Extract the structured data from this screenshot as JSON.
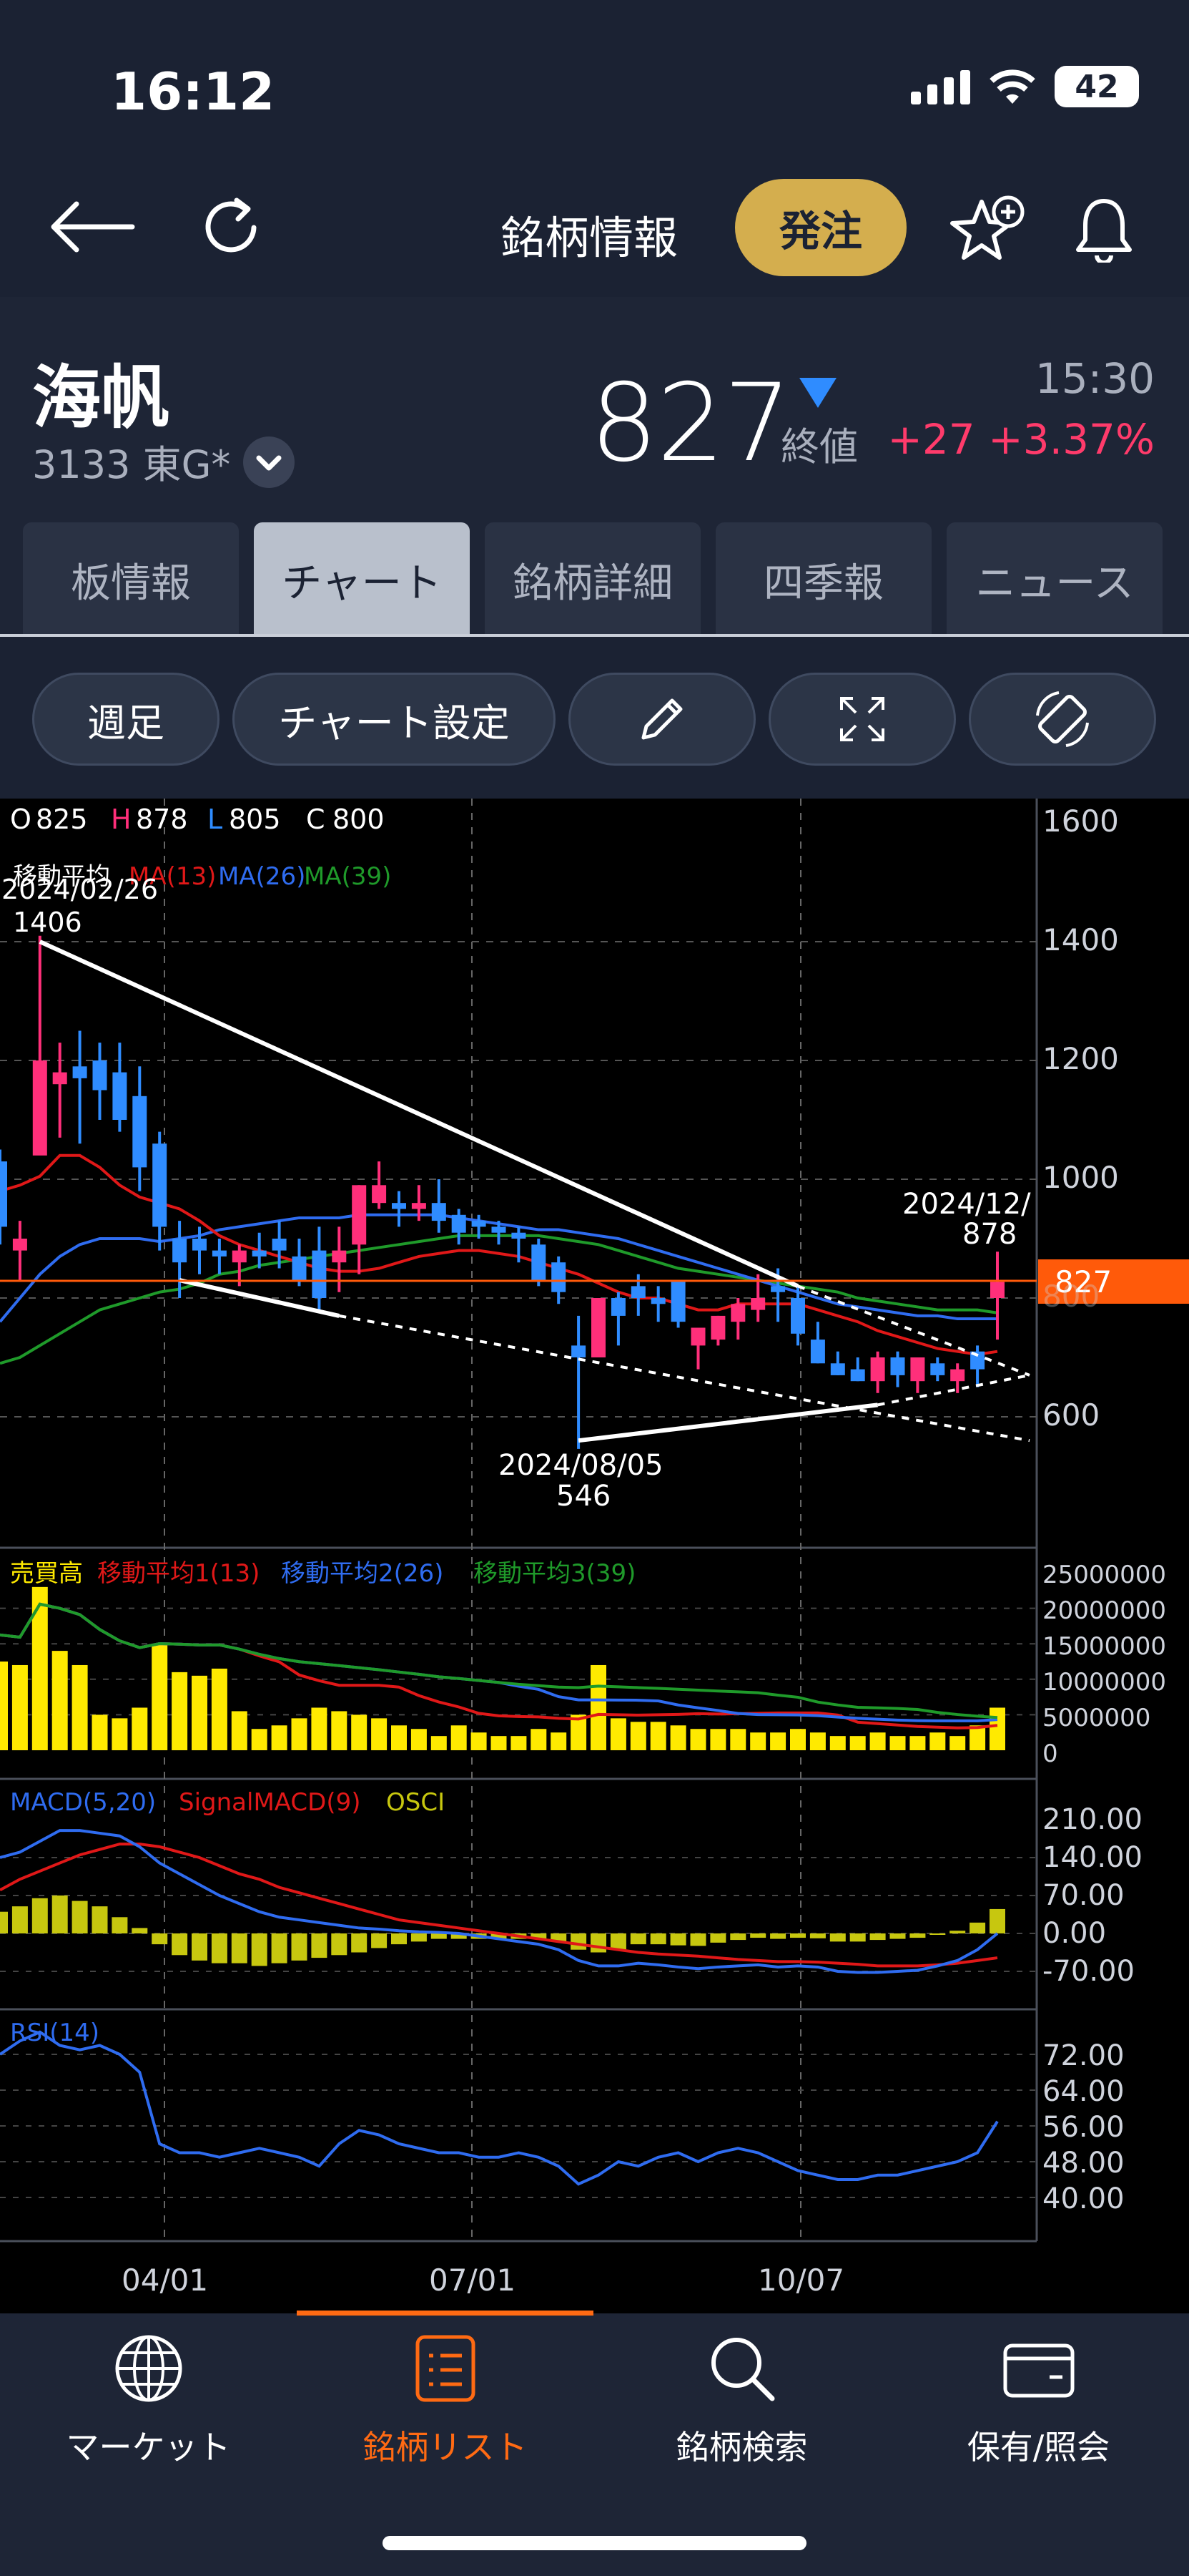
{
  "status_bar": {
    "time": "16:12",
    "battery": "42"
  },
  "nav": {
    "title": "銘柄情報",
    "order_button": "発注"
  },
  "stock": {
    "name": "海帆",
    "code_market": "3133 東G*",
    "price": "827",
    "price_label": "終値",
    "time": "15:30",
    "change": "+27 +3.37%"
  },
  "tabs": [
    {
      "label": "板情報",
      "active": false
    },
    {
      "label": "チャート",
      "active": true
    },
    {
      "label": "銘柄詳細",
      "active": false
    },
    {
      "label": "四季報",
      "active": false
    },
    {
      "label": "ニュース",
      "active": false
    }
  ],
  "toolbar": {
    "period": "週足",
    "settings": "チャート設定"
  },
  "chart": {
    "ohlc": {
      "o_label": "O",
      "o": "825",
      "h_label": "H",
      "h": "878",
      "l_label": "L",
      "l": "805",
      "c_label": "C",
      "c": "800"
    },
    "ma_legend": {
      "title": "移動平均",
      "ma13": "MA(13)",
      "ma26": "MA(26)",
      "ma39": "MA(39)"
    },
    "annotations": {
      "high_date": "2024/02/26",
      "high_value": "1406",
      "low_date": "2024/08/05",
      "low_value": "546",
      "last_date": "2024/12/",
      "last_value": "878"
    },
    "current_price_tag": "827",
    "price_axis": [
      "1600",
      "1400",
      "1200",
      "1000",
      "800",
      "600"
    ],
    "volume_legend": {
      "title": "売買高",
      "ma1": "移動平均1(13)",
      "ma2": "移動平均2(26)",
      "ma3": "移動平均3(39)"
    },
    "volume_axis": [
      "25000000",
      "20000000",
      "15000000",
      "10000000",
      "5000000",
      "0"
    ],
    "macd_legend": {
      "macd": "MACD(5,20)",
      "signal": "SignalMACD(9)",
      "osci": "OSCI"
    },
    "macd_axis": [
      "210.00",
      "140.00",
      "70.00",
      "0.00",
      "-70.00"
    ],
    "rsi_legend": "RSI(14)",
    "rsi_axis": [
      "72.00",
      "64.00",
      "56.00",
      "48.00",
      "40.00"
    ],
    "x_axis": [
      "04/01",
      "07/01",
      "10/07"
    ],
    "colors": {
      "up": "#ff2f7a",
      "down": "#2f8cff",
      "ma13": "#e01818",
      "ma26": "#2f6cf0",
      "ma39": "#1f9a2a",
      "volume": "#ffea00",
      "osci": "#c7c70f",
      "price_tag": "#ff5a0a"
    }
  },
  "chart_data": {
    "type": "candlestick",
    "period": "週足",
    "candles_ohlc": [
      [
        1030,
        1050,
        890,
        920
      ],
      [
        880,
        930,
        830,
        900
      ],
      [
        1040,
        1410,
        1150,
        1200
      ],
      [
        1160,
        1230,
        1070,
        1180
      ],
      [
        1190,
        1250,
        1060,
        1170
      ],
      [
        1200,
        1230,
        1100,
        1150
      ],
      [
        1180,
        1230,
        1080,
        1100
      ],
      [
        1140,
        1190,
        980,
        1020
      ],
      [
        1060,
        1080,
        880,
        920
      ],
      [
        900,
        930,
        800,
        860
      ],
      [
        900,
        920,
        840,
        880
      ],
      [
        880,
        900,
        840,
        870
      ],
      [
        860,
        890,
        820,
        880
      ],
      [
        880,
        910,
        850,
        870
      ],
      [
        900,
        930,
        850,
        880
      ],
      [
        870,
        900,
        820,
        830
      ],
      [
        880,
        920,
        780,
        800
      ],
      [
        860,
        920,
        810,
        880
      ],
      [
        890,
        990,
        840,
        990
      ],
      [
        960,
        1030,
        950,
        990
      ],
      [
        960,
        980,
        920,
        950
      ],
      [
        950,
        990,
        930,
        960
      ],
      [
        960,
        1000,
        910,
        930
      ],
      [
        940,
        950,
        890,
        910
      ],
      [
        930,
        940,
        900,
        920
      ],
      [
        920,
        930,
        890,
        910
      ],
      [
        910,
        920,
        860,
        900
      ],
      [
        890,
        900,
        820,
        830
      ],
      [
        860,
        870,
        790,
        810
      ],
      [
        720,
        770,
        546,
        700
      ],
      [
        700,
        740,
        700,
        800
      ],
      [
        800,
        810,
        720,
        770
      ],
      [
        820,
        840,
        770,
        800
      ],
      [
        800,
        820,
        760,
        790
      ],
      [
        830,
        830,
        750,
        760
      ],
      [
        720,
        740,
        680,
        750
      ],
      [
        730,
        770,
        720,
        770
      ],
      [
        760,
        800,
        730,
        790
      ],
      [
        780,
        840,
        760,
        800
      ],
      [
        820,
        850,
        760,
        810
      ],
      [
        800,
        820,
        720,
        740
      ],
      [
        730,
        760,
        690,
        690
      ],
      [
        690,
        710,
        670,
        670
      ],
      [
        680,
        700,
        660,
        660
      ],
      [
        660,
        710,
        640,
        700
      ],
      [
        700,
        710,
        650,
        670
      ],
      [
        660,
        700,
        640,
        700
      ],
      [
        690,
        700,
        660,
        670
      ],
      [
        660,
        690,
        640,
        680
      ],
      [
        710,
        720,
        650,
        680
      ],
      [
        800,
        878,
        730,
        827
      ]
    ],
    "x_ticks": [
      "04/01",
      "07/01",
      "10/07"
    ],
    "y_ticks": [
      1600,
      1400,
      1200,
      1000,
      800,
      600
    ],
    "ylim": [
      546,
      1650
    ],
    "ma13": [
      980,
      990,
      1005,
      1040,
      1040,
      1020,
      990,
      970,
      960,
      950,
      930,
      905,
      890,
      880,
      870,
      860,
      850,
      845,
      845,
      850,
      860,
      870,
      875,
      880,
      880,
      875,
      870,
      860,
      850,
      840,
      825,
      810,
      800,
      800,
      790,
      780,
      780,
      790,
      790,
      790,
      790,
      780,
      770,
      760,
      745,
      735,
      725,
      715,
      710,
      705,
      710
    ],
    "ma26": [
      760,
      800,
      840,
      870,
      890,
      900,
      900,
      900,
      895,
      900,
      905,
      915,
      920,
      925,
      930,
      935,
      935,
      935,
      940,
      940,
      940,
      940,
      940,
      935,
      930,
      925,
      920,
      915,
      915,
      910,
      905,
      900,
      890,
      880,
      870,
      860,
      850,
      840,
      830,
      820,
      810,
      800,
      790,
      785,
      780,
      775,
      770,
      770,
      765,
      765,
      765
    ],
    "ma39": [
      690,
      700,
      720,
      740,
      760,
      780,
      790,
      800,
      810,
      815,
      825,
      840,
      845,
      855,
      860,
      865,
      870,
      875,
      880,
      885,
      890,
      895,
      900,
      905,
      905,
      905,
      905,
      905,
      900,
      895,
      890,
      880,
      870,
      860,
      850,
      845,
      840,
      835,
      830,
      825,
      820,
      815,
      810,
      800,
      795,
      790,
      785,
      780,
      780,
      780,
      775
    ],
    "volume": [
      12500000,
      12000000,
      23000000,
      14000000,
      12000000,
      5000000,
      4500000,
      6000000,
      15000000,
      11000000,
      10500000,
      11500000,
      5500000,
      3000000,
      3500000,
      4500000,
      6000000,
      5500000,
      5000000,
      4500000,
      3500000,
      3000000,
      2000000,
      3500000,
      2500000,
      2000000,
      2000000,
      3000000,
      2500000,
      5000000,
      12000000,
      4500000,
      4000000,
      4000000,
      3500000,
      3000000,
      3000000,
      3000000,
      2500000,
      2500000,
      3000000,
      2500000,
      2000000,
      2000000,
      2500000,
      2000000,
      2000000,
      2500000,
      2000000,
      3500000,
      6000000
    ],
    "macd": [
      140,
      150,
      170,
      190,
      190,
      185,
      180,
      160,
      130,
      110,
      90,
      70,
      55,
      40,
      30,
      25,
      20,
      15,
      10,
      8,
      5,
      3,
      2,
      0,
      -5,
      -10,
      -15,
      -20,
      -30,
      -50,
      -60,
      -60,
      -55,
      -58,
      -62,
      -65,
      -62,
      -60,
      -58,
      -62,
      -60,
      -62,
      -70,
      -72,
      -72,
      -70,
      -68,
      -60,
      -50,
      -30,
      0
    ],
    "signal": [
      80,
      100,
      115,
      130,
      145,
      155,
      165,
      165,
      160,
      150,
      140,
      125,
      110,
      100,
      85,
      75,
      65,
      55,
      45,
      35,
      25,
      20,
      15,
      10,
      5,
      0,
      -5,
      -10,
      -15,
      -20,
      -25,
      -30,
      -35,
      -38,
      -40,
      -42,
      -45,
      -48,
      -50,
      -52,
      -52,
      -53,
      -55,
      -57,
      -60,
      -60,
      -60,
      -58,
      -55,
      -50,
      -45
    ],
    "osci": [
      40,
      50,
      65,
      70,
      60,
      50,
      30,
      10,
      -20,
      -40,
      -50,
      -55,
      -55,
      -60,
      -55,
      -50,
      -45,
      -40,
      -35,
      -27,
      -20,
      -15,
      -10,
      -10,
      -10,
      -10,
      -10,
      -10,
      -15,
      -30,
      -35,
      -30,
      -20,
      -20,
      -22,
      -23,
      -17,
      -12,
      -8,
      -10,
      -8,
      -9,
      -15,
      -15,
      -12,
      -10,
      -8,
      -2,
      5,
      20,
      45
    ],
    "rsi": [
      72,
      75,
      77,
      74,
      73,
      74,
      72,
      68,
      52,
      50,
      50,
      49,
      50,
      51,
      50,
      49,
      47,
      52,
      55,
      54,
      52,
      51,
      50,
      50,
      49,
      49,
      50,
      49,
      47,
      43,
      45,
      48,
      47,
      49,
      50,
      48,
      50,
      51,
      50,
      48,
      46,
      45,
      44,
      44,
      45,
      45,
      46,
      47,
      48,
      50,
      57
    ]
  }
}
